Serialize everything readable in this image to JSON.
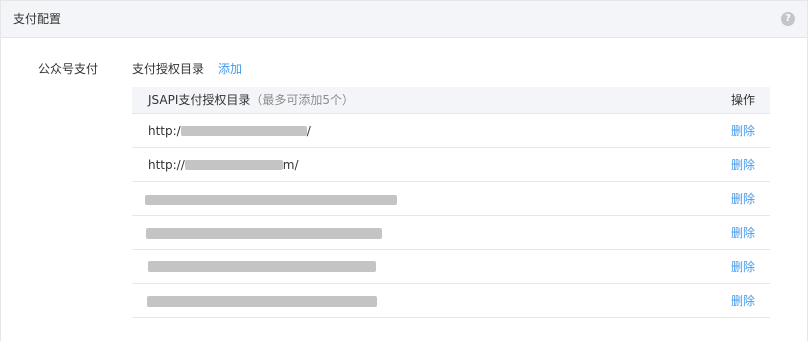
{
  "panel": {
    "title": "支付配置",
    "help_icon": "?"
  },
  "section": {
    "label": "公众号支付",
    "subtitle": "支付授权目录",
    "add_label": "添加"
  },
  "table": {
    "header": {
      "name_main": "JSAPI支付授权目录",
      "name_hint": "（最多可添加5个）",
      "op": "操作"
    },
    "rows": [
      {
        "url_prefix": "http:/",
        "url_suffix": "/",
        "delete_label": "删除"
      },
      {
        "url_prefix": "http://",
        "url_suffix": "m/",
        "delete_label": "删除"
      },
      {
        "url_prefix": "",
        "url_suffix": "",
        "delete_label": "删除"
      },
      {
        "url_prefix": "",
        "url_suffix": "",
        "delete_label": "删除"
      },
      {
        "url_prefix": "",
        "url_suffix": "",
        "delete_label": "删除"
      },
      {
        "url_prefix": "",
        "url_suffix": "",
        "delete_label": "删除"
      }
    ]
  },
  "colors": {
    "link": "#459ae9",
    "header_bg": "#f4f5f9",
    "redaction": "#c4c4c4",
    "border": "#e7e7eb"
  }
}
